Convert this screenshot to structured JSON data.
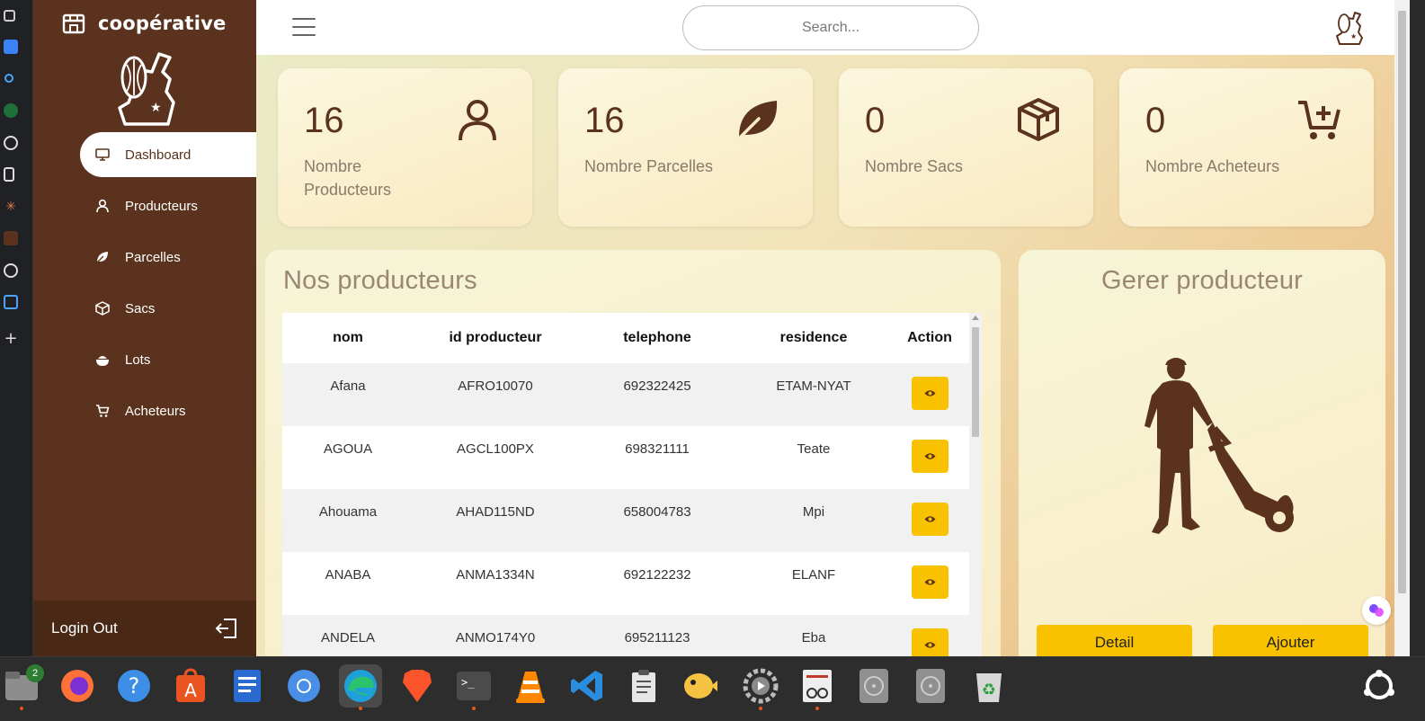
{
  "app": {
    "name": "coopérative"
  },
  "sidebar": {
    "items": [
      {
        "label": "Dashboard",
        "icon": "monitor-icon",
        "active": true
      },
      {
        "label": "Producteurs",
        "icon": "user-icon"
      },
      {
        "label": "Parcelles",
        "icon": "leaf-icon"
      },
      {
        "label": "Sacs",
        "icon": "box-icon"
      },
      {
        "label": "Lots",
        "icon": "bowl-icon"
      },
      {
        "label": "Acheteurs",
        "icon": "cart-icon"
      }
    ],
    "logout_label": "Login Out"
  },
  "topbar": {
    "search_placeholder": "Search..."
  },
  "stats": [
    {
      "value": "16",
      "label": "Nombre Producteurs",
      "icon": "user-icon"
    },
    {
      "value": "16",
      "label": "Nombre Parcelles",
      "icon": "leaf-icon"
    },
    {
      "value": "0",
      "label": "Nombre Sacs",
      "icon": "box-icon"
    },
    {
      "value": "0",
      "label": "Nombre Acheteurs",
      "icon": "cart-plus-icon"
    }
  ],
  "producers_panel": {
    "title": "Nos producteurs",
    "columns": [
      "nom",
      "id producteur",
      "telephone",
      "residence",
      "Action"
    ],
    "rows": [
      {
        "nom": "Afana",
        "id": "AFRO10070",
        "tel": "692322425",
        "res": "ETAM-NYAT"
      },
      {
        "nom": "AGOUA",
        "id": "AGCL100PX",
        "tel": "698321111",
        "res": "Teate"
      },
      {
        "nom": "Ahouama",
        "id": "AHAD115ND",
        "tel": "658004783",
        "res": "Mpi"
      },
      {
        "nom": "ANABA",
        "id": "ANMA1334N",
        "tel": "692122232",
        "res": "ELANF"
      },
      {
        "nom": "ANDELA",
        "id": "ANMO174Y0",
        "tel": "695211123",
        "res": "Eba"
      }
    ]
  },
  "manage_panel": {
    "title": "Gerer producteur",
    "detail_label": "Detail",
    "add_label": "Ajouter"
  },
  "taskbar": {
    "files_badge": "2"
  },
  "colors": {
    "brown": "#5a321d",
    "yellow": "#f9c200"
  }
}
